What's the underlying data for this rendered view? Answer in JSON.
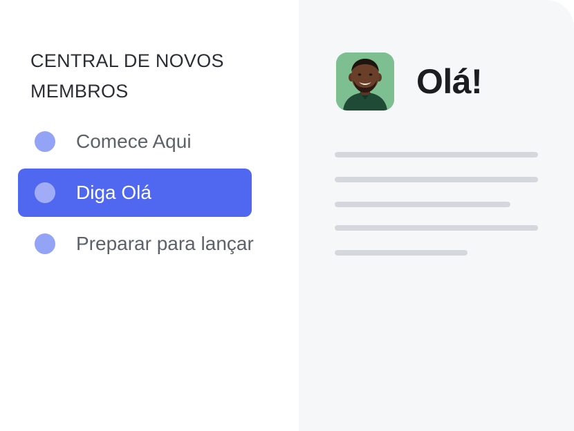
{
  "sidebar": {
    "title_line1": "CENTRAL DE NOVOS",
    "title_line2": "MEMBROS",
    "items": [
      {
        "label": "Comece Aqui",
        "active": false
      },
      {
        "label": "Diga Olá",
        "active": true
      },
      {
        "label": "Preparar para lançar",
        "active": false
      }
    ]
  },
  "main": {
    "greeting": "Olá!",
    "avatar_icon": "person-avatar"
  },
  "colors": {
    "accent": "#5068EF",
    "dot": "#93A4F6",
    "panel_bg": "#F6F7F9",
    "placeholder_line": "#D4D8DD",
    "avatar_bg": "#7DBF90"
  }
}
